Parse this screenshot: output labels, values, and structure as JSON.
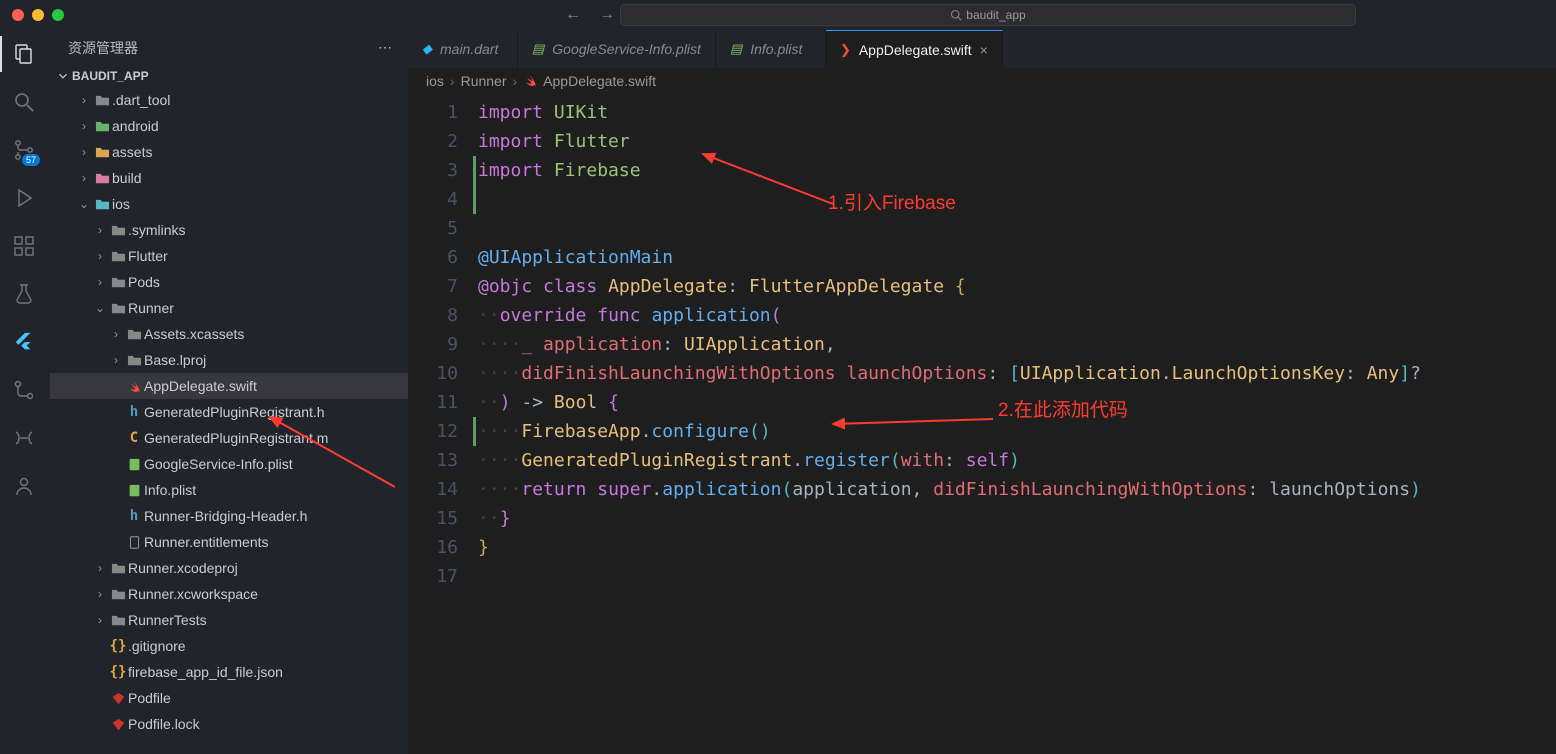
{
  "title_bar": {
    "search_text": "baudit_app"
  },
  "activity": {
    "scm_badge": "57"
  },
  "sidebar": {
    "title": "资源管理器",
    "project": "BAUDIT_APP",
    "tree": [
      {
        "depth": 1,
        "chev": "r",
        "icon": "folder",
        "label": ".dart_tool"
      },
      {
        "depth": 1,
        "chev": "r",
        "icon": "folder-green",
        "label": "android"
      },
      {
        "depth": 1,
        "chev": "r",
        "icon": "folder-yellow",
        "label": "assets"
      },
      {
        "depth": 1,
        "chev": "r",
        "icon": "folder-pink",
        "label": "build"
      },
      {
        "depth": 1,
        "chev": "d",
        "icon": "folder-teal",
        "label": "ios"
      },
      {
        "depth": 2,
        "chev": "r",
        "icon": "folder",
        "label": ".symlinks"
      },
      {
        "depth": 2,
        "chev": "r",
        "icon": "folder",
        "label": "Flutter"
      },
      {
        "depth": 2,
        "chev": "r",
        "icon": "folder",
        "label": "Pods"
      },
      {
        "depth": 2,
        "chev": "d",
        "icon": "folder",
        "label": "Runner"
      },
      {
        "depth": 3,
        "chev": "r",
        "icon": "folder",
        "label": "Assets.xcassets"
      },
      {
        "depth": 3,
        "chev": "r",
        "icon": "folder",
        "label": "Base.lproj"
      },
      {
        "depth": 3,
        "chev": "",
        "icon": "swift",
        "label": "AppDelegate.swift",
        "selected": true
      },
      {
        "depth": 3,
        "chev": "",
        "icon": "h",
        "label": "GeneratedPluginRegistrant.h"
      },
      {
        "depth": 3,
        "chev": "",
        "icon": "c",
        "label": "GeneratedPluginRegistrant.m"
      },
      {
        "depth": 3,
        "chev": "",
        "icon": "plist",
        "label": "GoogleService-Info.plist"
      },
      {
        "depth": 3,
        "chev": "",
        "icon": "plist",
        "label": "Info.plist"
      },
      {
        "depth": 3,
        "chev": "",
        "icon": "h",
        "label": "Runner-Bridging-Header.h"
      },
      {
        "depth": 3,
        "chev": "",
        "icon": "generic",
        "label": "Runner.entitlements"
      },
      {
        "depth": 2,
        "chev": "r",
        "icon": "folder",
        "label": "Runner.xcodeproj"
      },
      {
        "depth": 2,
        "chev": "r",
        "icon": "folder",
        "label": "Runner.xcworkspace"
      },
      {
        "depth": 2,
        "chev": "r",
        "icon": "folder",
        "label": "RunnerTests"
      },
      {
        "depth": 2,
        "chev": "",
        "icon": "json",
        "label": ".gitignore"
      },
      {
        "depth": 2,
        "chev": "",
        "icon": "json",
        "label": "firebase_app_id_file.json"
      },
      {
        "depth": 2,
        "chev": "",
        "icon": "ruby",
        "label": "Podfile"
      },
      {
        "depth": 2,
        "chev": "",
        "icon": "ruby",
        "label": "Podfile.lock"
      }
    ]
  },
  "tabs": [
    {
      "icon": "dart",
      "icon_color": "#29b6f6",
      "label": "main.dart",
      "active": false
    },
    {
      "icon": "plist",
      "icon_color": "#7bbb5e",
      "label": "GoogleService-Info.plist",
      "active": false
    },
    {
      "icon": "plist",
      "icon_color": "#7bbb5e",
      "label": "Info.plist",
      "active": false
    },
    {
      "icon": "swift",
      "icon_color": "#f05138",
      "label": "AppDelegate.swift",
      "active": true,
      "close": true
    }
  ],
  "breadcrumb": {
    "parts": [
      "ios",
      "Runner",
      "AppDelegate.swift"
    ],
    "file_icon": "swift"
  },
  "code": {
    "lines": [
      {
        "n": 1,
        "mod": false,
        "tokens": [
          [
            "keyword",
            "import"
          ],
          [
            "plain",
            " "
          ],
          [
            "import",
            "UIKit"
          ]
        ]
      },
      {
        "n": 2,
        "mod": false,
        "tokens": [
          [
            "keyword",
            "import"
          ],
          [
            "plain",
            " "
          ],
          [
            "import",
            "Flutter"
          ]
        ]
      },
      {
        "n": 3,
        "mod": true,
        "tokens": [
          [
            "keyword",
            "import"
          ],
          [
            "plain",
            " "
          ],
          [
            "import",
            "Firebase"
          ]
        ]
      },
      {
        "n": 4,
        "mod": true,
        "tokens": []
      },
      {
        "n": 5,
        "mod": false,
        "tokens": []
      },
      {
        "n": 6,
        "mod": false,
        "tokens": [
          [
            "at",
            "@UIApplicationMain"
          ]
        ]
      },
      {
        "n": 7,
        "mod": false,
        "tokens": [
          [
            "keyword",
            "@objc"
          ],
          [
            "plain",
            " "
          ],
          [
            "keyword",
            "class"
          ],
          [
            "plain",
            " "
          ],
          [
            "type",
            "AppDelegate"
          ],
          [
            "punct",
            ": "
          ],
          [
            "type",
            "FlutterAppDelegate"
          ],
          [
            "plain",
            " "
          ],
          [
            "brace",
            "{"
          ]
        ]
      },
      {
        "n": 8,
        "mod": false,
        "tokens": [
          [
            "ws",
            "··"
          ],
          [
            "keyword",
            "override"
          ],
          [
            "plain",
            " "
          ],
          [
            "keyword",
            "func"
          ],
          [
            "plain",
            " "
          ],
          [
            "func",
            "application"
          ],
          [
            "brace2",
            "("
          ]
        ]
      },
      {
        "n": 9,
        "mod": false,
        "tokens": [
          [
            "ws",
            "····"
          ],
          [
            "param",
            "_"
          ],
          [
            "plain",
            " "
          ],
          [
            "param",
            "application"
          ],
          [
            "punct",
            ": "
          ],
          [
            "type",
            "UIApplication"
          ],
          [
            "punct",
            ","
          ]
        ]
      },
      {
        "n": 10,
        "mod": false,
        "tokens": [
          [
            "ws",
            "····"
          ],
          [
            "param",
            "didFinishLaunchingWithOptions"
          ],
          [
            "plain",
            " "
          ],
          [
            "param",
            "launchOptions"
          ],
          [
            "punct",
            ": "
          ],
          [
            "brace3",
            "["
          ],
          [
            "type",
            "UIApplication"
          ],
          [
            "punct",
            "."
          ],
          [
            "type",
            "LaunchOptionsKey"
          ],
          [
            "punct",
            ": "
          ],
          [
            "any",
            "Any"
          ],
          [
            "brace3",
            "]"
          ],
          [
            "punct",
            "?"
          ]
        ]
      },
      {
        "n": 11,
        "mod": false,
        "tokens": [
          [
            "ws",
            "··"
          ],
          [
            "brace2",
            ")"
          ],
          [
            "plain",
            " "
          ],
          [
            "punct",
            "->"
          ],
          [
            "plain",
            " "
          ],
          [
            "type",
            "Bool"
          ],
          [
            "plain",
            " "
          ],
          [
            "brace2",
            "{"
          ]
        ]
      },
      {
        "n": 12,
        "mod": true,
        "tokens": [
          [
            "ws",
            "····"
          ],
          [
            "type",
            "FirebaseApp"
          ],
          [
            "punct",
            "."
          ],
          [
            "func",
            "configure"
          ],
          [
            "brace3",
            "("
          ],
          [
            "brace3",
            ")"
          ]
        ]
      },
      {
        "n": 13,
        "mod": false,
        "tokens": [
          [
            "ws",
            "····"
          ],
          [
            "type",
            "GeneratedPluginRegistrant"
          ],
          [
            "punct",
            "."
          ],
          [
            "func",
            "register"
          ],
          [
            "brace3",
            "("
          ],
          [
            "param",
            "with"
          ],
          [
            "punct",
            ": "
          ],
          [
            "keyword",
            "self"
          ],
          [
            "brace3",
            ")"
          ]
        ]
      },
      {
        "n": 14,
        "mod": false,
        "tokens": [
          [
            "ws",
            "····"
          ],
          [
            "keyword",
            "return"
          ],
          [
            "plain",
            " "
          ],
          [
            "keyword",
            "super"
          ],
          [
            "punct",
            "."
          ],
          [
            "func",
            "application"
          ],
          [
            "brace3",
            "("
          ],
          [
            "plain",
            "application"
          ],
          [
            "punct",
            ", "
          ],
          [
            "param",
            "didFinishLaunchingWithOptions"
          ],
          [
            "punct",
            ": "
          ],
          [
            "plain",
            "launchOptions"
          ],
          [
            "brace3",
            ")"
          ]
        ]
      },
      {
        "n": 15,
        "mod": false,
        "tokens": [
          [
            "ws",
            "··"
          ],
          [
            "brace2",
            "}"
          ]
        ]
      },
      {
        "n": 16,
        "mod": false,
        "tokens": [
          [
            "brace",
            "}"
          ]
        ]
      },
      {
        "n": 17,
        "mod": false,
        "tokens": []
      }
    ]
  },
  "annotations": {
    "a1": "1.引入Firebase",
    "a2": "2.在此添加代码"
  }
}
